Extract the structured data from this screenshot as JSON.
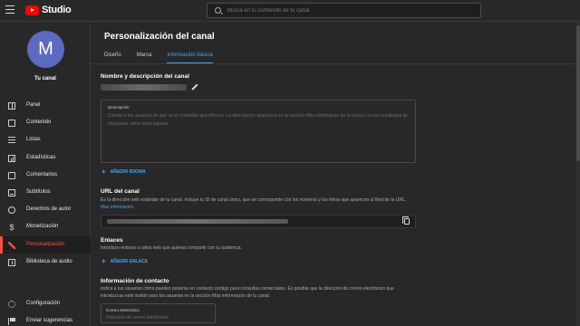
{
  "app": {
    "brand": "Studio",
    "search_placeholder": "Busca en tu contenido de tu canal"
  },
  "sidebar": {
    "avatar_letter": "M",
    "channel_label": "Tu canal",
    "items": [
      {
        "label": "Panel",
        "icon": "dashboard-icon"
      },
      {
        "label": "Contenido",
        "icon": "content-icon"
      },
      {
        "label": "Listas",
        "icon": "playlists-icon"
      },
      {
        "label": "Estadísticas",
        "icon": "analytics-icon"
      },
      {
        "label": "Comentarios",
        "icon": "comments-icon"
      },
      {
        "label": "Subtítulos",
        "icon": "subtitles-icon"
      },
      {
        "label": "Derechos de autor",
        "icon": "copyright-icon"
      },
      {
        "label": "Monetización",
        "icon": "monetization-icon"
      },
      {
        "label": "Personalización",
        "icon": "customization-icon",
        "active": true
      },
      {
        "label": "Biblioteca de audio",
        "icon": "audio-library-icon"
      }
    ],
    "bottom_items": [
      {
        "label": "Configuración",
        "icon": "gear-icon"
      },
      {
        "label": "Enviar sugerencias",
        "icon": "feedback-icon"
      }
    ],
    "active_color": "#ff4e45"
  },
  "main": {
    "title": "Personalización del canal",
    "tabs": [
      {
        "label": "Diseño"
      },
      {
        "label": "Marca"
      },
      {
        "label": "Información básica",
        "active": true
      }
    ],
    "accent_color": "#3ea6ff",
    "name_section": {
      "title": "Nombre y descripción del canal",
      "description_label": "Descripción",
      "description_placeholder": "Cuenta a los usuarios de qué va el contenido que ofreces. La descripción aparecerá en la sección Más información de tu canal y en los resultados de búsqueda, entre otros lugares.",
      "add_language": "AÑADIR IDIOMA"
    },
    "url_section": {
      "title": "URL del canal",
      "desc": "Es la dirección web estándar de tu canal. Incluye tu ID de canal único, que se corresponde con los números y las letras que aparecen al final de la URL.",
      "more_info": "Más información"
    },
    "links_section": {
      "title": "Enlaces",
      "desc": "Introduce enlaces a sitios web que quieras compartir con tu audiencia.",
      "add_link": "AÑADIR ENLACE"
    },
    "contact_section": {
      "title": "Información de contacto",
      "desc": "Indica a tus usuarios cómo pueden ponerse en contacto contigo para consultas comerciales. Es posible que la dirección de correo electrónico que introduzcas esté visible para los usuarios en la sección Más información de tu canal.",
      "email_label": "Correo electrónico",
      "email_placeholder": "Dirección de correo electrónico"
    }
  }
}
